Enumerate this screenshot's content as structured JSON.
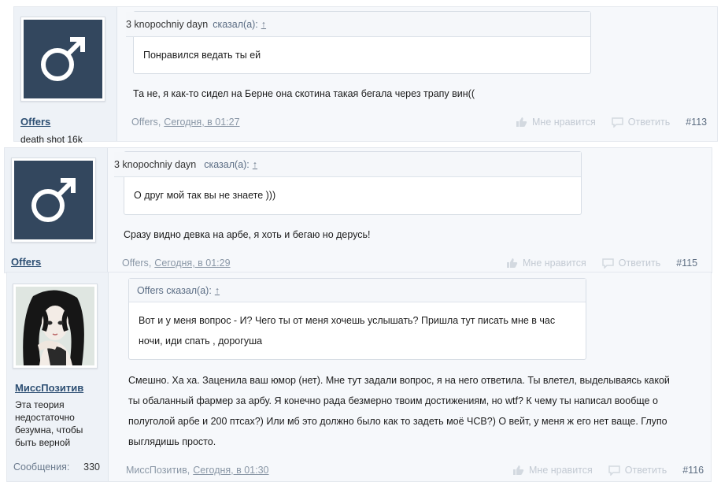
{
  "posts": [
    {
      "quote_author": "3 knopochniy dayn",
      "quote_said": "сказал(а):",
      "quote_arrow": "↑",
      "quote_text": "Понравился ведать ты ей",
      "message": "Та не, я как-то сидел на Берне она скотина такая бегала через трапу вин((",
      "author": "Offers",
      "author_title": "death shot 16k",
      "date": "Сегодня, в 01:27",
      "like_label": "Мне нравится",
      "reply_label": "Ответить",
      "number": "#113"
    },
    {
      "quote_author": "3 knopochniy dayn",
      "quote_said": "сказал(а):",
      "quote_arrow": "↑",
      "quote_text": "О друг мой так вы не знаете )))",
      "message": "Сразу видно девка на арбе, я хоть и бегаю но дерусь!",
      "author": "Offers",
      "date": "Сегодня, в 01:29",
      "like_label": "Мне нравится",
      "reply_label": "Ответить",
      "number": "#115"
    },
    {
      "quote_author": "Offers сказал(а):",
      "quote_arrow": "↑",
      "quote_text_lines": [
        "Вот и у меня вопрос - И? Чего ты от меня хочешь услышать? Пришла тут писать мне в час",
        "ночи, иди спать , дорогуша"
      ],
      "message_lines": [
        "Смешно. Ха ха. Заценила ваш юмор (нет). Мне тут задали вопрос, я на него ответила. Ты влетел, выделываясь какой",
        "ты обаланный фармер за арбу. Я конечно рада безмерно твоим достижениям, но wtf? К чему ты написал вообще о",
        "полуголой арбе и 200 птсах?) Или мб это должно было как то задеть моё ЧСВ?) О вейт, у меня ж его нет ваще. Глупо",
        "выглядишь просто."
      ],
      "author": "МиссПозитив",
      "author_title_lines": [
        "Эта теория",
        "недостаточно",
        "безумна, чтобы",
        "быть верной"
      ],
      "stat_label": "Сообщения:",
      "stat_value": "330",
      "date": "Сегодня, в 01:30",
      "like_label": "Мне нравится",
      "reply_label": "Ответить",
      "number": "#116"
    }
  ],
  "icons": {
    "male": "male-symbol-icon",
    "like": "thumbs-up-icon",
    "reply": "speech-bubble-icon"
  },
  "colors": {
    "avatar_bg": "#33475e",
    "link": "#2d4f73",
    "muted": "#8a97a6"
  }
}
